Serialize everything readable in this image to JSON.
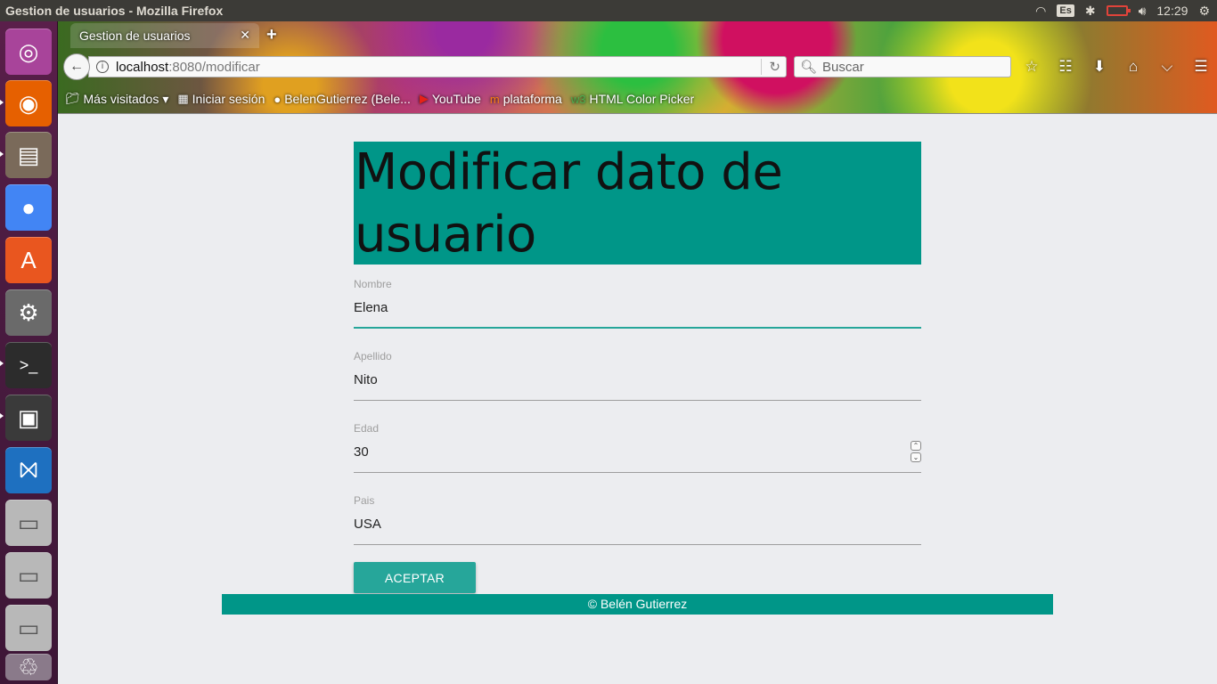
{
  "top_panel": {
    "window_title": "Gestion de usuarios - Mozilla Firefox",
    "keyboard": "Es",
    "time": "12:29"
  },
  "launcher": {
    "items": [
      "ubuntu-dash-icon",
      "firefox-icon",
      "files-icon",
      "chrome-icon",
      "software-center-icon",
      "system-settings-icon",
      "terminal-icon",
      "safe-icon",
      "vscode-icon",
      "drive-icon",
      "drive-icon",
      "drive-icon",
      "trash-icon"
    ]
  },
  "browser": {
    "tab_title": "Gestion de usuarios",
    "url_host": "localhost",
    "url_path": ":8080/modificar",
    "search_placeholder": "Buscar",
    "bookmarks": [
      {
        "label": "Más visitados",
        "icon": "folder-icon"
      },
      {
        "label": "Iniciar sesión",
        "icon": "microsoft-icon"
      },
      {
        "label": "BelenGutierrez (Bele...",
        "icon": "github-icon"
      },
      {
        "label": "YouTube",
        "icon": "youtube-icon"
      },
      {
        "label": "plataforma",
        "icon": "moodle-icon"
      },
      {
        "label": "HTML Color Picker",
        "icon": "w3-icon"
      }
    ]
  },
  "page": {
    "title": "Modificar dato de usuario",
    "fields": [
      {
        "label": "Nombre",
        "value": "Elena"
      },
      {
        "label": "Apellido",
        "value": "Nito"
      },
      {
        "label": "Edad",
        "value": "30"
      },
      {
        "label": "Pais",
        "value": "USA"
      }
    ],
    "accept_label": "ACEPTAR",
    "footer": "© Belén Gutierrez"
  },
  "colors": {
    "primary": "#009688",
    "accent": "#26a69a",
    "page_bg": "#ecedf0"
  }
}
